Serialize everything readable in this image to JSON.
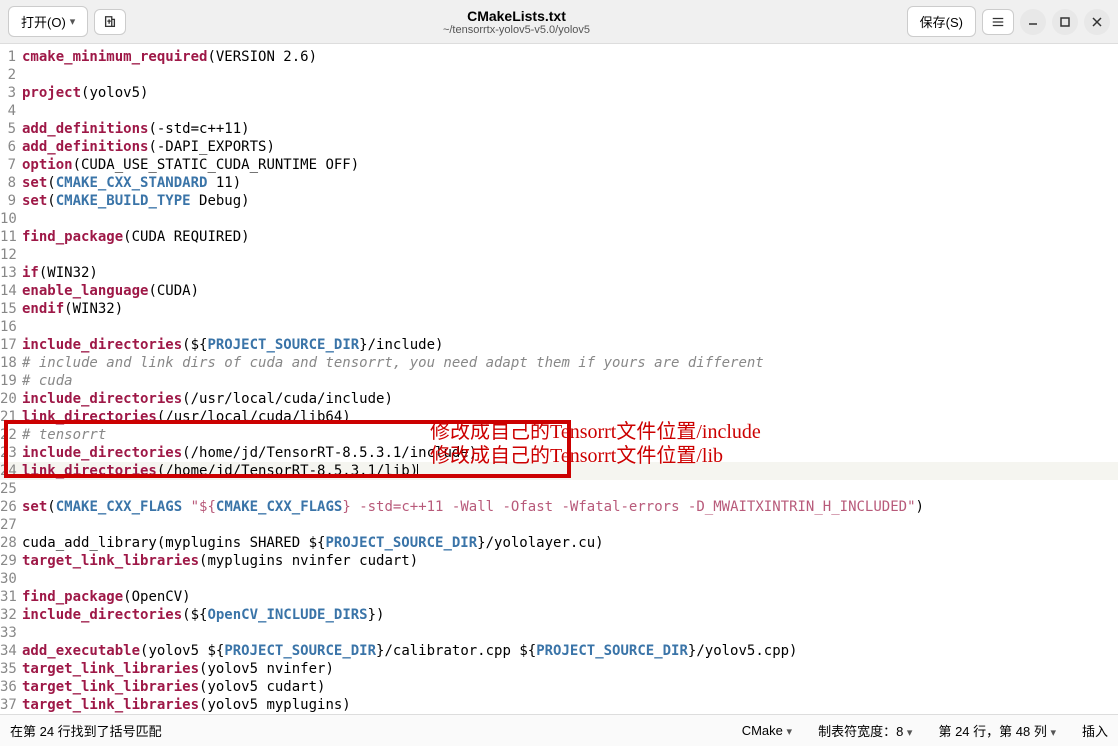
{
  "header": {
    "open_label": "打开(O)",
    "save_label": "保存(S)",
    "title": "CMakeLists.txt",
    "subtitle": "~/tensorrtx-yolov5-v5.0/yolov5"
  },
  "code_lines": [
    {
      "n": 1,
      "html": "<span class='kw'>cmake_minimum_required</span>(VERSION 2.6)"
    },
    {
      "n": 2,
      "html": ""
    },
    {
      "n": 3,
      "html": "<span class='kw'>project</span>(yolov5)"
    },
    {
      "n": 4,
      "html": ""
    },
    {
      "n": 5,
      "html": "<span class='kw'>add_definitions</span>(-std=c++11)"
    },
    {
      "n": 6,
      "html": "<span class='kw'>add_definitions</span>(-DAPI_EXPORTS)"
    },
    {
      "n": 7,
      "html": "<span class='kw'>option</span>(CUDA_USE_STATIC_CUDA_RUNTIME OFF)"
    },
    {
      "n": 8,
      "html": "<span class='kw'>set</span>(<span class='var'>CMAKE_CXX_STANDARD</span> 11)"
    },
    {
      "n": 9,
      "html": "<span class='kw'>set</span>(<span class='var'>CMAKE_BUILD_TYPE</span> Debug)"
    },
    {
      "n": 10,
      "html": ""
    },
    {
      "n": 11,
      "html": "<span class='kw'>find_package</span>(CUDA REQUIRED)"
    },
    {
      "n": 12,
      "html": ""
    },
    {
      "n": 13,
      "html": "<span class='kw'>if</span>(WIN32)"
    },
    {
      "n": 14,
      "html": "<span class='kw'>enable_language</span>(CUDA)"
    },
    {
      "n": 15,
      "html": "<span class='kw'>endif</span>(WIN32)"
    },
    {
      "n": 16,
      "html": ""
    },
    {
      "n": 17,
      "html": "<span class='kw'>include_directories</span>(${<span class='var'>PROJECT_SOURCE_DIR</span>}/include)"
    },
    {
      "n": 18,
      "html": "<span class='cm'># include and link dirs of cuda and tensorrt, you need adapt them if yours are different</span>"
    },
    {
      "n": 19,
      "html": "<span class='cm'># cuda</span>"
    },
    {
      "n": 20,
      "html": "<span class='kw'>include_directories</span>(/usr/local/cuda/include)"
    },
    {
      "n": 21,
      "html": "<span class='kw'>link_directories</span>(/usr/local/cuda/lib64)"
    },
    {
      "n": 22,
      "html": "<span class='cm'># tensorrt</span>"
    },
    {
      "n": 23,
      "html": "<span class='kw'>include_directories</span>(/home/jd/TensorRT-8.5.3.1/include)"
    },
    {
      "n": 24,
      "html": "<span class='kw'>link_directories</span>(/home/jd/TensorRT-8.5.3.1/lib)<span class='cursor'></span>",
      "current": true
    },
    {
      "n": 25,
      "html": ""
    },
    {
      "n": 26,
      "html": "<span class='kw'>set</span>(<span class='var'>CMAKE_CXX_FLAGS</span> <span class='str'>\"${</span><span class='var'>CMAKE_CXX_FLAGS</span><span class='str'>} -std=c++11 -Wall -Ofast -Wfatal-errors -D_MWAITXINTRIN_H_INCLUDED\"</span>)"
    },
    {
      "n": 27,
      "html": ""
    },
    {
      "n": 28,
      "html": "cuda_add_library(myplugins SHARED ${<span class='var'>PROJECT_SOURCE_DIR</span>}/yololayer.cu)"
    },
    {
      "n": 29,
      "html": "<span class='kw'>target_link_libraries</span>(myplugins nvinfer cudart)"
    },
    {
      "n": 30,
      "html": ""
    },
    {
      "n": 31,
      "html": "<span class='kw'>find_package</span>(OpenCV)"
    },
    {
      "n": 32,
      "html": "<span class='kw'>include_directories</span>(${<span class='var'>OpenCV_INCLUDE_DIRS</span>})"
    },
    {
      "n": 33,
      "html": ""
    },
    {
      "n": 34,
      "html": "<span class='kw'>add_executable</span>(yolov5 ${<span class='var'>PROJECT_SOURCE_DIR</span>}/calibrator.cpp ${<span class='var'>PROJECT_SOURCE_DIR</span>}/yolov5.cpp)"
    },
    {
      "n": 35,
      "html": "<span class='kw'>target_link_libraries</span>(yolov5 nvinfer)"
    },
    {
      "n": 36,
      "html": "<span class='kw'>target_link_libraries</span>(yolov5 cudart)"
    },
    {
      "n": 37,
      "html": "<span class='kw'>target_link_libraries</span>(yolov5 myplugins)"
    }
  ],
  "annotations": {
    "line1": "修改成自己的Tensorrt文件位置/include",
    "line2": "修改成自己的Tensorrt文件位置/lib"
  },
  "statusbar": {
    "left": "在第 24 行找到了括号匹配",
    "lang": "CMake",
    "tab_label": "制表符宽度：8",
    "pos": "第 24 行，第 48 列",
    "mode": "插入"
  }
}
